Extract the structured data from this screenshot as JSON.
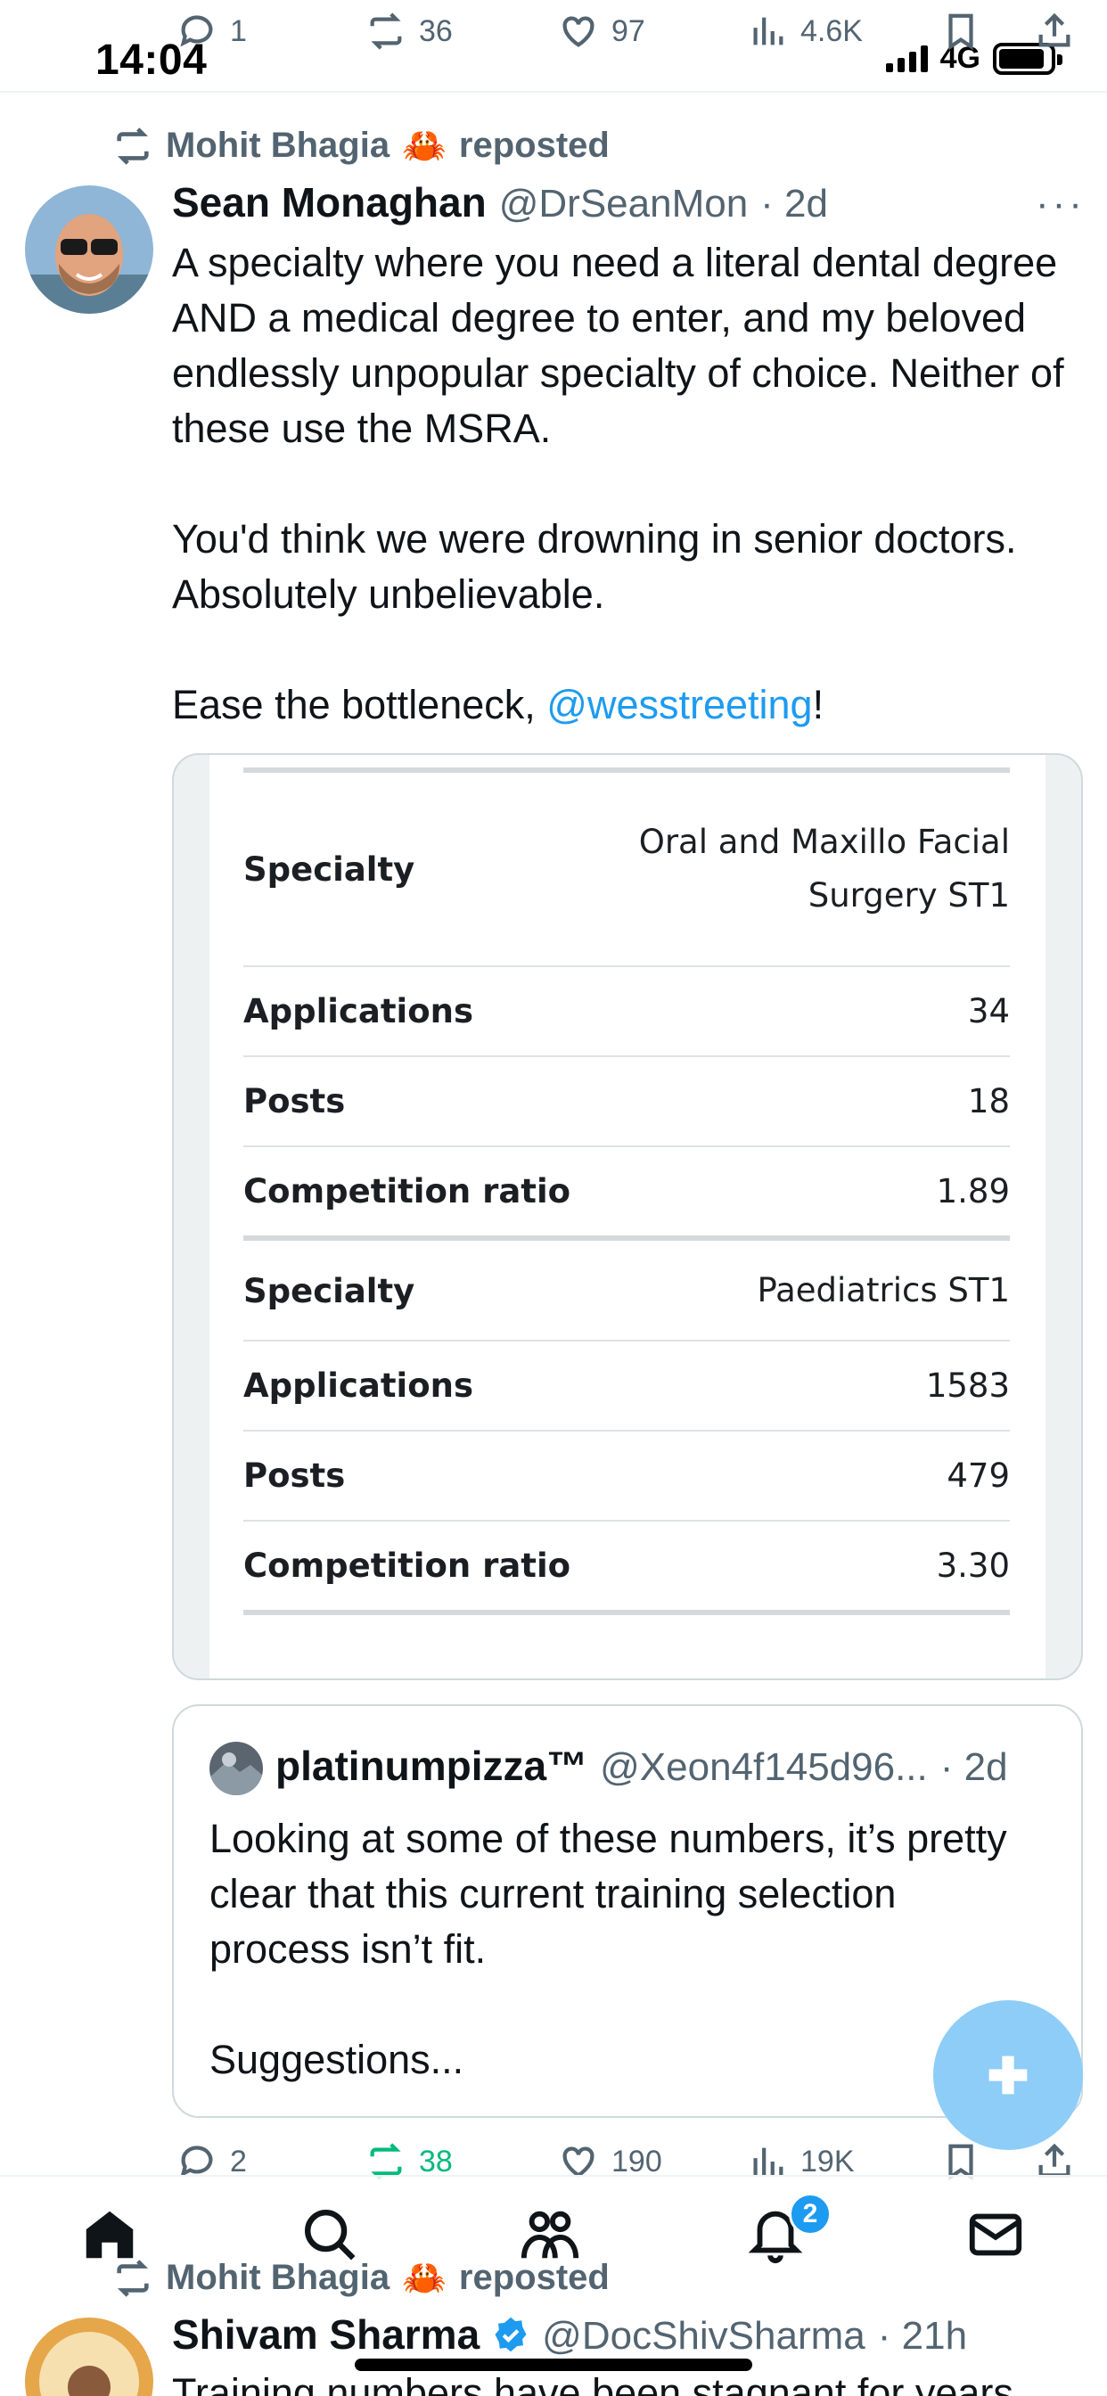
{
  "status_bar": {
    "time": "14:04",
    "network": "4G"
  },
  "prev_tweet_actions": {
    "replies": "1",
    "reposts": "36",
    "likes": "97",
    "views": "4.6K"
  },
  "tweet": {
    "reposted_by": "Mohit Bhagia",
    "reposted_emoji": "🦀",
    "reposted_label": "reposted",
    "author_name": "Sean Monaghan",
    "author_handle": "@DrSeanMon",
    "time_ago": "· 2d",
    "paragraph_1": "A specialty where you need a literal dental degree AND a medical degree to enter, and my beloved endlessly unpopular specialty of choice. Neither of these use the MSRA.",
    "paragraph_2": "You'd think we were drowning in senior doctors. Absolutely unbelievable.",
    "paragraph_3_prefix": "Ease the bottleneck, ",
    "paragraph_3_mention": "@wesstreeting",
    "paragraph_3_suffix": "!",
    "image_table": {
      "blocks": [
        {
          "rows": [
            {
              "key": "Specialty",
              "value_line1": "Oral and Maxillo Facial",
              "value_line2": "Surgery ST1"
            },
            {
              "key": "Applications",
              "value": "34"
            },
            {
              "key": "Posts",
              "value": "18"
            },
            {
              "key": "Competition ratio",
              "value": "1.89"
            }
          ]
        },
        {
          "rows": [
            {
              "key": "Specialty",
              "value": "Paediatrics ST1"
            },
            {
              "key": "Applications",
              "value": "1583"
            },
            {
              "key": "Posts",
              "value": "479"
            },
            {
              "key": "Competition ratio",
              "value": "3.30"
            }
          ]
        }
      ]
    },
    "quote": {
      "author_name": "platinumpizza™",
      "author_handle": "@Xeon4f145d96...",
      "time_ago": "· 2d",
      "paragraph_1": "Looking at some of these numbers, it’s pretty clear that this current training selection process isn’t fit.",
      "paragraph_2": "Suggestions..."
    },
    "actions": {
      "replies": "2",
      "reposts": "38",
      "likes": "190",
      "views": "19K"
    }
  },
  "next_tweet": {
    "reposted_by": "Mohit Bhagia",
    "reposted_emoji": "🦀",
    "reposted_label": "reposted",
    "author_name": "Shivam Sharma",
    "author_handle": "@DocShivSharma",
    "time_ago": "· 21h",
    "text_partial": "Training numbers have been stagnant for years"
  },
  "bottom_nav": {
    "notifications_badge": "2"
  },
  "colors": {
    "accent": "#1d9bf0",
    "repost_green": "#00ba7c",
    "muted": "#536471",
    "fab": "#8ecdf7"
  }
}
